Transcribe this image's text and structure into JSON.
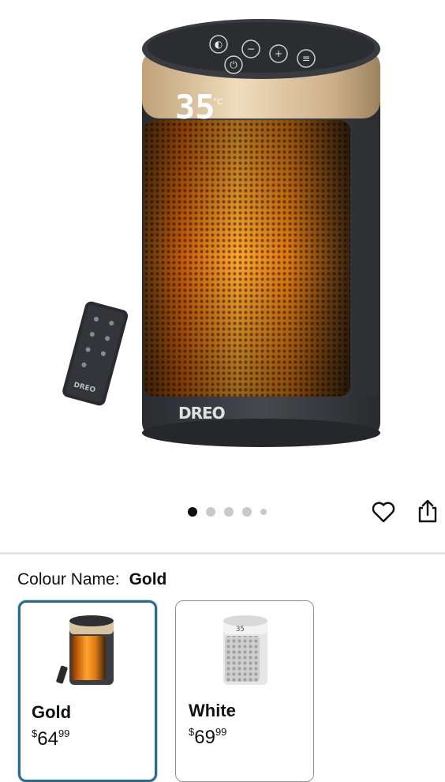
{
  "product_image": {
    "display_temp": "35",
    "temp_unit": "°C",
    "brand": "DREO",
    "remote_brand": "DREO"
  },
  "carousel": {
    "count": 5,
    "active_index": 0
  },
  "actions": {
    "favorite_icon": "heart-outline-icon",
    "share_icon": "share-icon"
  },
  "colour": {
    "label": "Colour Name:",
    "selected": "Gold"
  },
  "variants": [
    {
      "name": "Gold",
      "currency": "$",
      "price_whole": "64",
      "price_fraction": "99",
      "selected": true
    },
    {
      "name": "White",
      "currency": "$",
      "price_whole": "69",
      "price_fraction": "99",
      "selected": false
    }
  ],
  "colors": {
    "selected_border": "#2d6a8a",
    "heater_body": "#3b3d42",
    "heater_ring": "#d8c3a0",
    "heater_glow": "#ff8a1c"
  }
}
